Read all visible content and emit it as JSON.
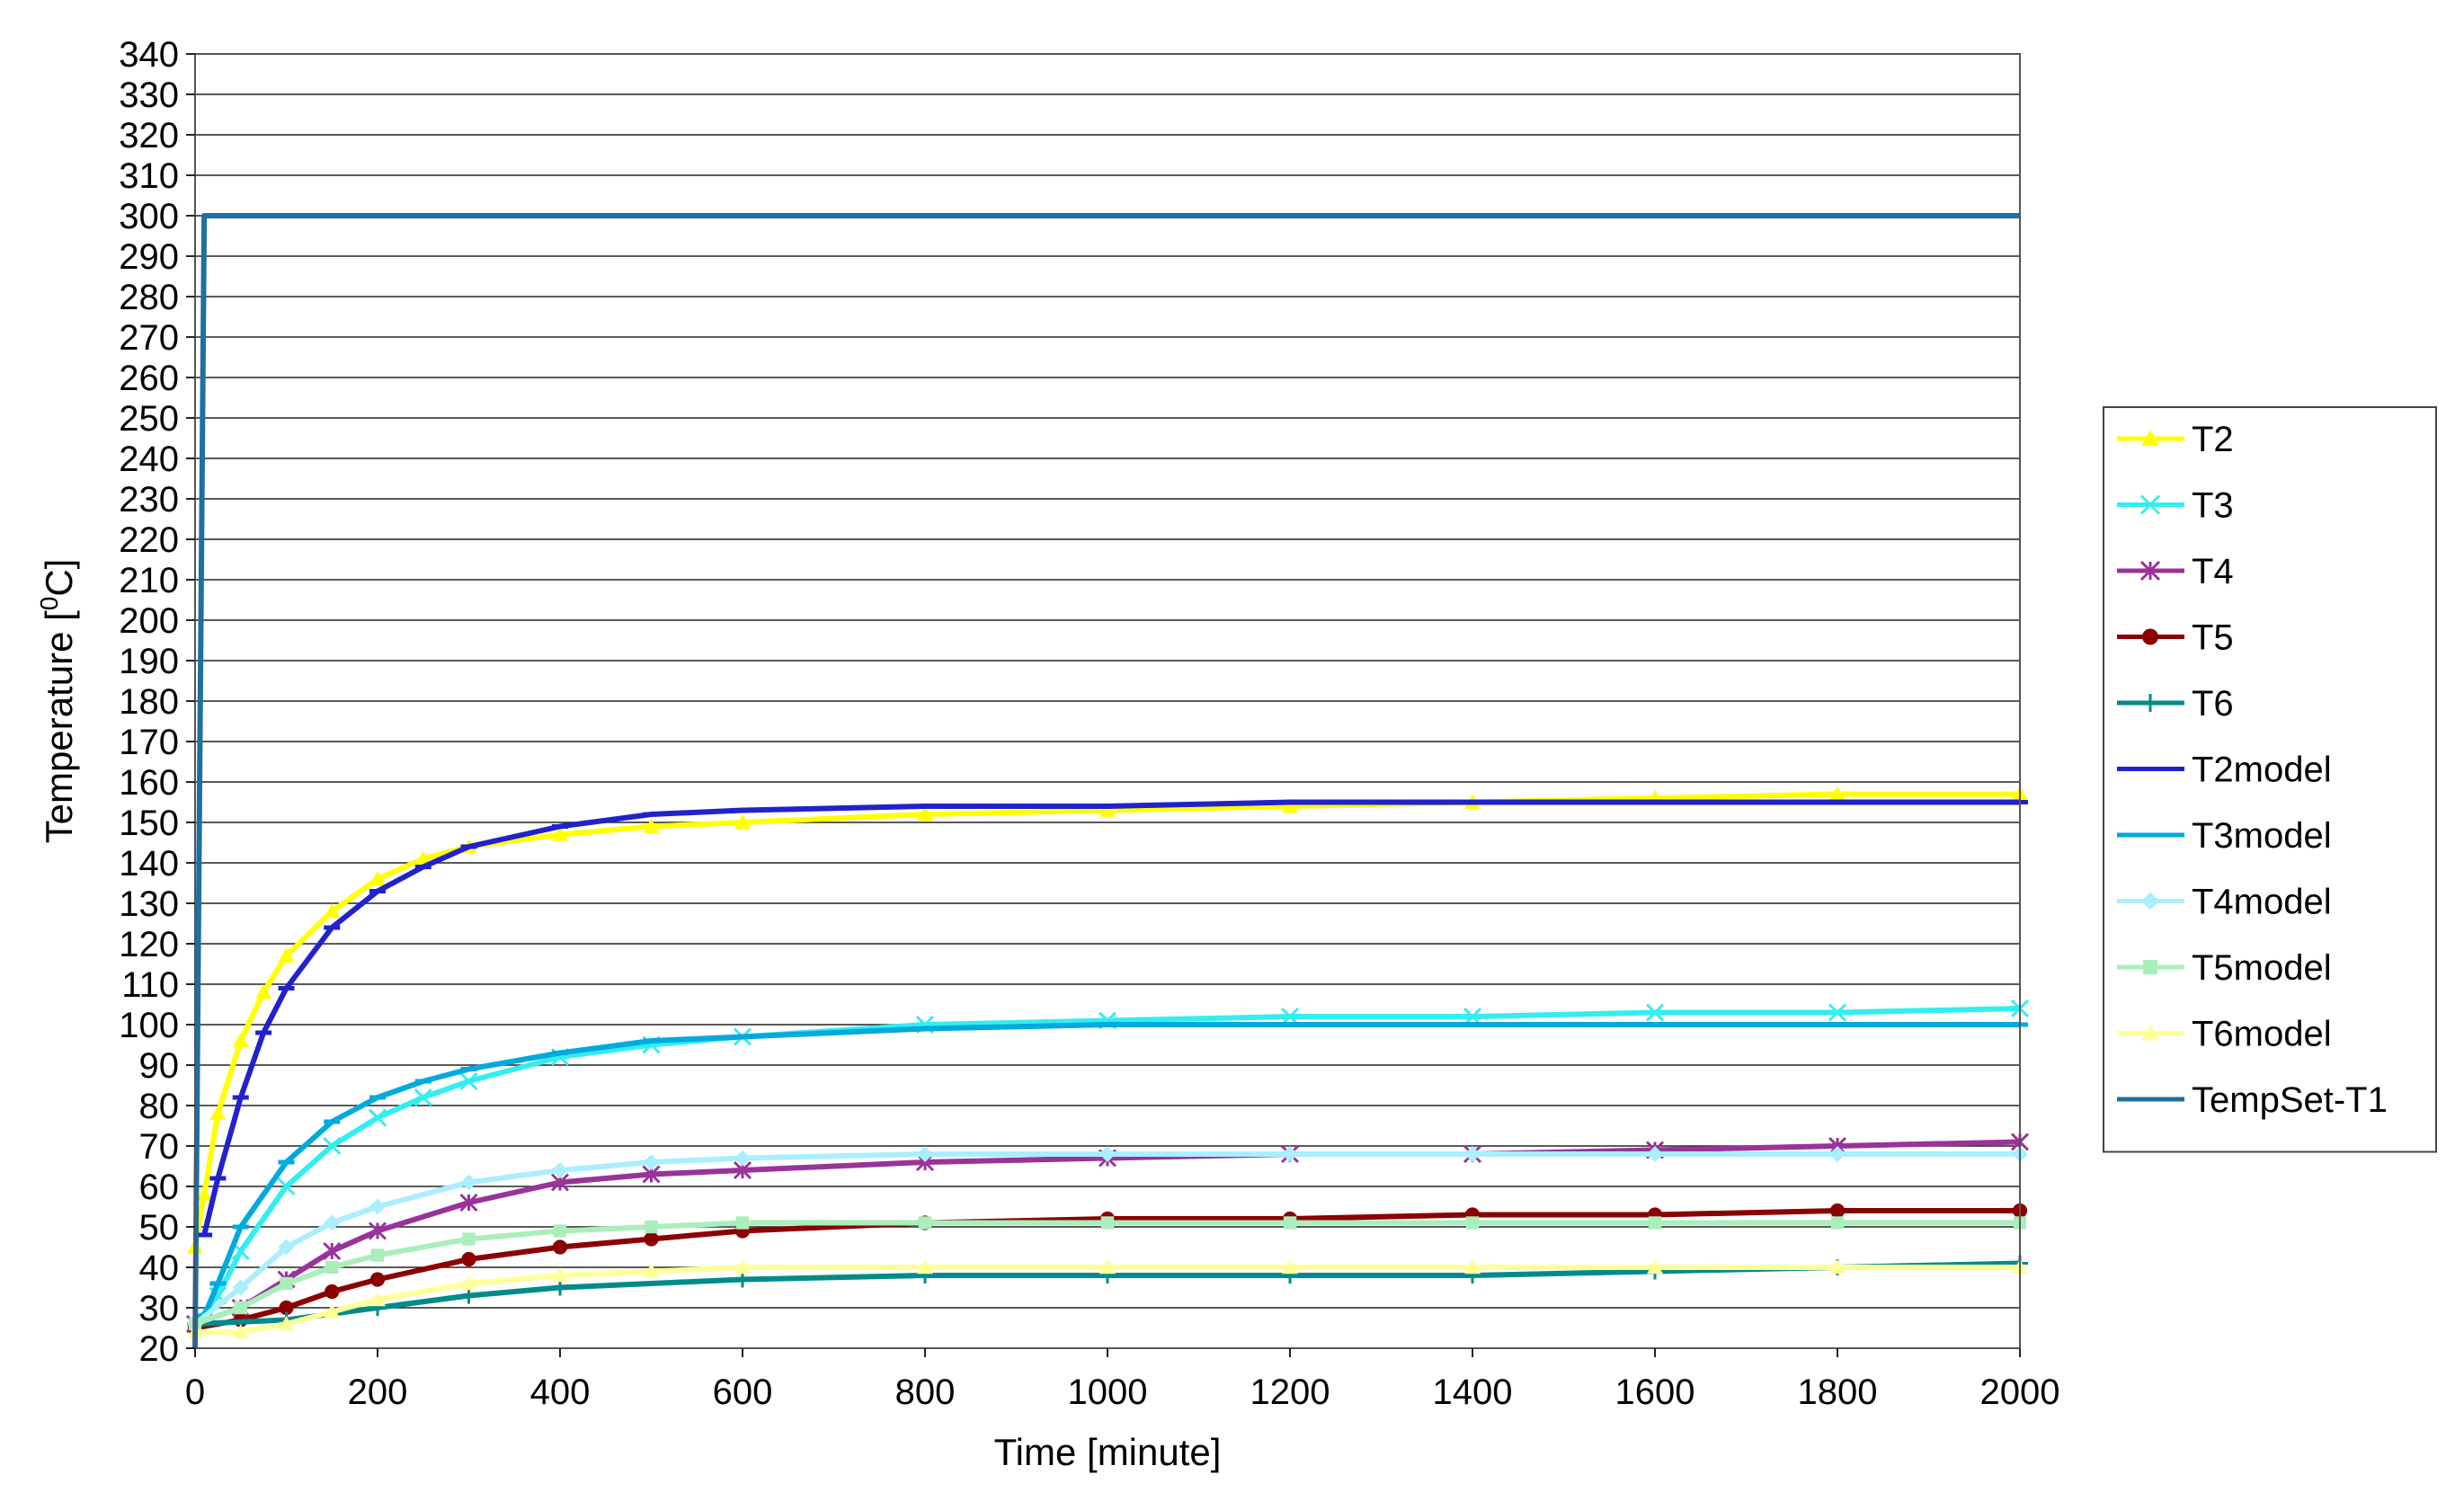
{
  "chart_data": {
    "type": "line",
    "title": "",
    "xlabel": "Time [minute]",
    "ylabel": "Temperature [°C]",
    "ylabel_parts": [
      "Temperature [",
      "0",
      "C]"
    ],
    "xlim": [
      0,
      2000
    ],
    "ylim": [
      20,
      340
    ],
    "x_ticks": [
      0,
      200,
      400,
      600,
      800,
      1000,
      1200,
      1400,
      1600,
      1800,
      2000
    ],
    "y_ticks": [
      20,
      30,
      40,
      50,
      60,
      70,
      80,
      90,
      100,
      110,
      120,
      130,
      140,
      150,
      160,
      170,
      180,
      190,
      200,
      210,
      220,
      230,
      240,
      250,
      260,
      270,
      280,
      290,
      300,
      310,
      320,
      330,
      340
    ],
    "grid": "horizontal",
    "legend_position": "right",
    "series": [
      {
        "name": "T2",
        "color": "#FFFF00",
        "marker": "triangle",
        "x": [
          0,
          10,
          25,
          50,
          75,
          100,
          150,
          200,
          250,
          300,
          400,
          500,
          600,
          800,
          1000,
          1200,
          1400,
          1600,
          1800,
          2000
        ],
        "y": [
          45,
          58,
          78,
          96,
          108,
          117,
          128,
          136,
          141,
          144,
          147,
          149,
          150,
          152,
          153,
          154,
          155,
          156,
          157,
          157
        ]
      },
      {
        "name": "T3",
        "color": "#33EEEE",
        "marker": "x",
        "x": [
          0,
          25,
          50,
          100,
          150,
          200,
          250,
          300,
          400,
          500,
          600,
          800,
          1000,
          1200,
          1400,
          1600,
          1800,
          2000
        ],
        "y": [
          26,
          33,
          44,
          60,
          70,
          77,
          82,
          86,
          92,
          95,
          97,
          100,
          101,
          102,
          102,
          103,
          103,
          104
        ]
      },
      {
        "name": "T4",
        "color": "#993399",
        "marker": "asterisk",
        "x": [
          0,
          50,
          100,
          150,
          200,
          300,
          400,
          500,
          600,
          800,
          1000,
          1200,
          1400,
          1600,
          1800,
          2000
        ],
        "y": [
          26,
          30,
          37,
          44,
          49,
          56,
          61,
          63,
          64,
          66,
          67,
          68,
          68,
          69,
          70,
          71
        ]
      },
      {
        "name": "T5",
        "color": "#8B0000",
        "marker": "circle",
        "x": [
          0,
          50,
          100,
          150,
          200,
          300,
          400,
          500,
          600,
          800,
          1000,
          1200,
          1400,
          1600,
          1800,
          2000
        ],
        "y": [
          25,
          27,
          30,
          34,
          37,
          42,
          45,
          47,
          49,
          51,
          52,
          52,
          53,
          53,
          54,
          54
        ]
      },
      {
        "name": "T6",
        "color": "#008B8B",
        "marker": "plus",
        "x": [
          0,
          100,
          200,
          300,
          400,
          600,
          800,
          1000,
          1200,
          1400,
          1600,
          1800,
          2000
        ],
        "y": [
          26,
          27,
          30,
          33,
          35,
          37,
          38,
          38,
          38,
          38,
          39,
          40,
          41
        ]
      },
      {
        "name": "T2model",
        "color": "#2222CC",
        "marker": "dash",
        "x": [
          10,
          25,
          50,
          75,
          100,
          150,
          200,
          250,
          300,
          400,
          500,
          600,
          800,
          1000,
          1200,
          1400,
          1600,
          1800,
          2000
        ],
        "y": [
          48,
          62,
          82,
          98,
          109,
          124,
          133,
          139,
          144,
          149,
          152,
          153,
          154,
          154,
          155,
          155,
          155,
          155,
          155
        ]
      },
      {
        "name": "T3model",
        "color": "#00AADD",
        "marker": "dash",
        "x": [
          10,
          25,
          50,
          100,
          150,
          200,
          250,
          300,
          400,
          500,
          600,
          800,
          1000,
          1200,
          1400,
          1600,
          1800,
          2000
        ],
        "y": [
          28,
          36,
          50,
          66,
          76,
          82,
          86,
          89,
          93,
          96,
          97,
          99,
          100,
          100,
          100,
          100,
          100,
          100
        ]
      },
      {
        "name": "T4model",
        "color": "#AAEEFF",
        "marker": "diamond",
        "x": [
          0,
          50,
          100,
          150,
          200,
          300,
          400,
          500,
          600,
          800,
          1000,
          1200,
          1400,
          1600,
          1800,
          2000
        ],
        "y": [
          26,
          35,
          45,
          51,
          55,
          61,
          64,
          66,
          67,
          68,
          68,
          68,
          68,
          68,
          68,
          68
        ]
      },
      {
        "name": "T5model",
        "color": "#AAEEBB",
        "marker": "square",
        "x": [
          0,
          50,
          100,
          150,
          200,
          300,
          400,
          500,
          600,
          800,
          1000,
          1200,
          1400,
          1600,
          1800,
          2000
        ],
        "y": [
          26,
          30,
          36,
          40,
          43,
          47,
          49,
          50,
          51,
          51,
          51,
          51,
          51,
          51,
          51,
          51
        ]
      },
      {
        "name": "T6model",
        "color": "#FFFF99",
        "marker": "triangle",
        "x": [
          0,
          50,
          100,
          150,
          200,
          300,
          400,
          500,
          600,
          800,
          1000,
          1200,
          1400,
          1600,
          1800,
          2000
        ],
        "y": [
          24,
          24,
          26,
          29,
          32,
          36,
          38,
          39,
          40,
          40,
          40,
          40,
          40,
          40,
          40,
          40
        ]
      },
      {
        "name": "TempSet-T1",
        "color": "#1F6FA0",
        "marker": "line",
        "x": [
          0,
          10,
          20,
          100,
          200,
          400,
          600,
          800,
          1000,
          1200,
          1400,
          1600,
          1800,
          2000
        ],
        "y": [
          20,
          300,
          300,
          300,
          300,
          300,
          300,
          300,
          300,
          300,
          300,
          300,
          300,
          300
        ]
      }
    ]
  }
}
